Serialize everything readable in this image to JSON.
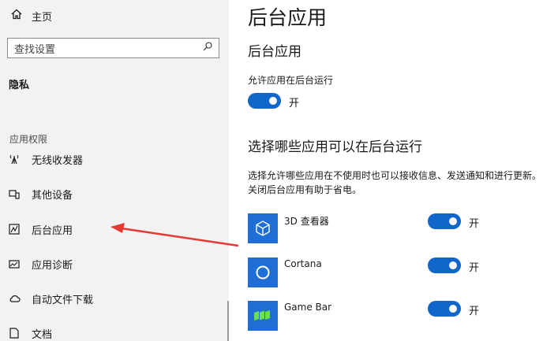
{
  "sidebar": {
    "home_label": "主页",
    "search_placeholder": "查找设置",
    "privacy_label": "隐私",
    "section_label": "应用权限",
    "items": [
      {
        "label": "无线收发器",
        "icon": "radio-tower-icon"
      },
      {
        "label": "其他设备",
        "icon": "devices-icon"
      },
      {
        "label": "后台应用",
        "icon": "background-apps-icon"
      },
      {
        "label": "应用诊断",
        "icon": "app-diagnostics-icon"
      },
      {
        "label": "自动文件下载",
        "icon": "cloud-icon"
      },
      {
        "label": "文档",
        "icon": "document-icon"
      }
    ]
  },
  "content": {
    "page_title": "后台应用",
    "section_title": "后台应用",
    "allow_label": "允许应用在后台运行",
    "allow_toggle_text": "开",
    "choose_title": "选择哪些应用可以在后台运行",
    "description": "选择允许哪些应用在不使用时也可以接收信息、发送通知和进行更新。关闭后台应用有助于省电。",
    "apps": [
      {
        "name": "3D 查看器",
        "toggle_text": "开",
        "icon": "3d-viewer-icon"
      },
      {
        "name": "Cortana",
        "toggle_text": "开",
        "icon": "cortana-icon"
      },
      {
        "name": "Game Bar",
        "toggle_text": "开",
        "icon": "game-bar-icon"
      }
    ]
  },
  "colors": {
    "accent": "#1166cc",
    "arrow": "#e53935",
    "sidebar_bg": "#f2f2f2"
  }
}
